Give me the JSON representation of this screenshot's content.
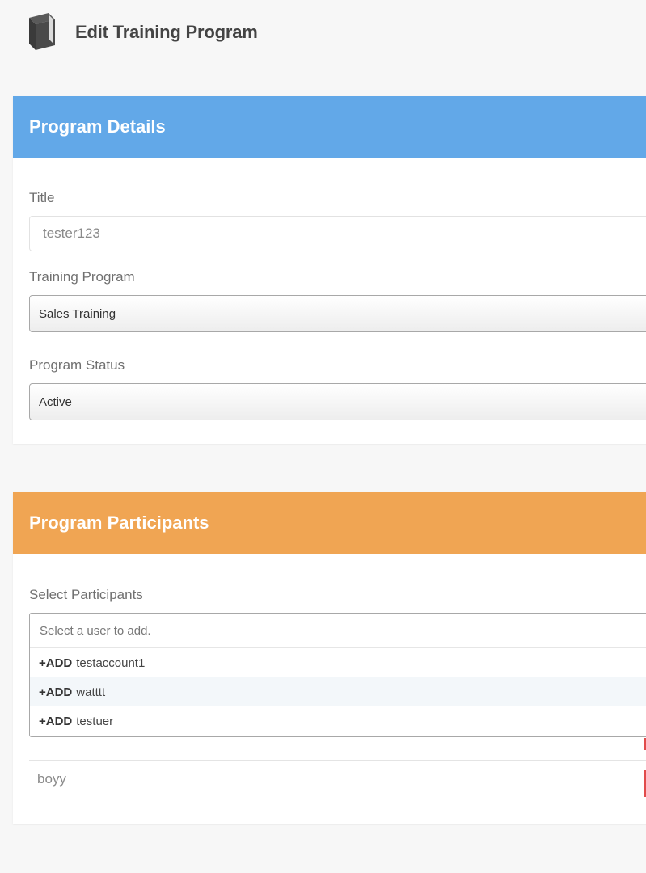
{
  "header": {
    "title": "Edit Training Program",
    "icon": "book-icon"
  },
  "program_details": {
    "heading": "Program Details",
    "accent": "#62a8e8",
    "title_label": "Title",
    "title_value": "tester123",
    "training_program_label": "Training Program",
    "training_program_value": "Sales Training",
    "status_label": "Program Status",
    "status_value": "Active"
  },
  "program_participants": {
    "heading": "Program Participants",
    "accent": "#f0a553",
    "select_label": "Select Participants",
    "search_placeholder": "Select a user to add.",
    "options": [
      {
        "prefix": "+ADD",
        "name": "testaccount1"
      },
      {
        "prefix": "+ADD",
        "name": "watttt"
      },
      {
        "prefix": "+ADD",
        "name": "testuer"
      }
    ],
    "participants": [
      {
        "name": "boyy"
      }
    ],
    "remove_color": "#e14b4b"
  }
}
